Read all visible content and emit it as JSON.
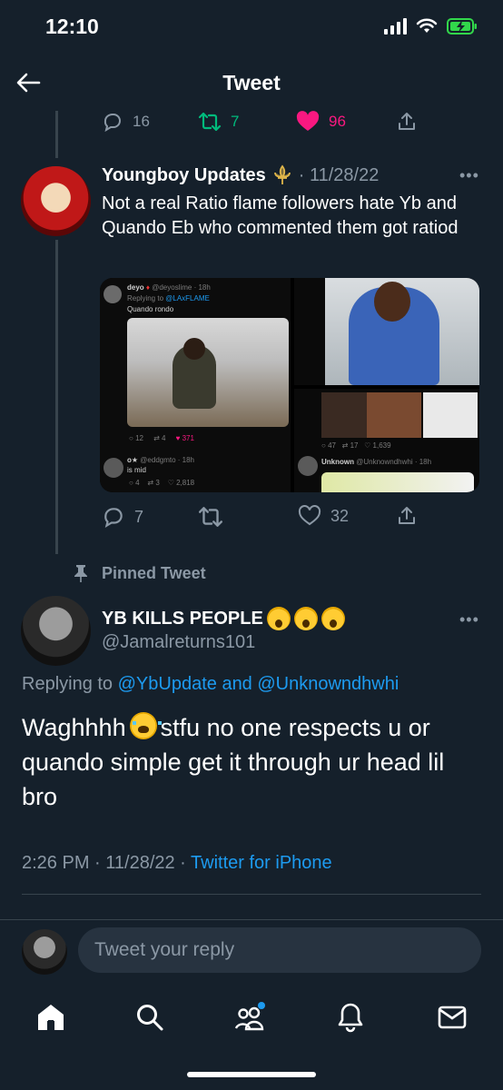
{
  "status_bar": {
    "time": "12:10"
  },
  "header": {
    "title": "Tweet"
  },
  "prev_tweet_actions": {
    "replies": "16",
    "retweets": "7",
    "likes": "96"
  },
  "tweet1": {
    "author": "Youngboy Updates",
    "date": "· 11/28/22",
    "text": "Not a real Ratio flame followers hate Yb and Quando Eb who commented them got ratiod",
    "media": {
      "left": {
        "user": "deyo",
        "handle": "@deyoslime · 18h",
        "replying_prefix": "Replying to",
        "replying_to": "@LAxFLAME",
        "text": "Quando rondo",
        "replies": "12",
        "retweets": "4",
        "likes": "371",
        "user2": "o★",
        "handle2": "@eddgmto · 18h",
        "text2": "is mid",
        "replies2": "4",
        "retweets2": "3",
        "likes2": "2,818"
      },
      "right": {
        "replies": "47",
        "retweets": "17",
        "likes": "1,639",
        "user": "Unknown",
        "handle": "@Unknowndhwhi · 18h"
      }
    },
    "actions": {
      "replies": "7",
      "likes": "32"
    }
  },
  "pinned": {
    "label": "Pinned Tweet"
  },
  "main_tweet": {
    "author": "YB KILLS PEOPLE",
    "handle": "@Jamalreturns101",
    "replying_prefix": "Replying to",
    "replying_to": "@YbUpdate and @Unknowndhwhi",
    "text_part1": "Waghhhh",
    "text_part2": "stfu no one respects u or quando simple get it through ur head lil bro",
    "time_date": "2:26 PM · 11/28/22 ·",
    "source": "Twitter for iPhone"
  },
  "reply_bar": {
    "placeholder": "Tweet your reply"
  },
  "colors": {
    "background": "#15202b",
    "accent": "#1d9bf0",
    "like": "#f91880",
    "retweet": "#00ba7c",
    "muted": "#8b98a5"
  },
  "icons": {
    "tabs": [
      "home-icon",
      "search-icon",
      "communities-icon",
      "notifications-icon",
      "messages-icon"
    ]
  }
}
